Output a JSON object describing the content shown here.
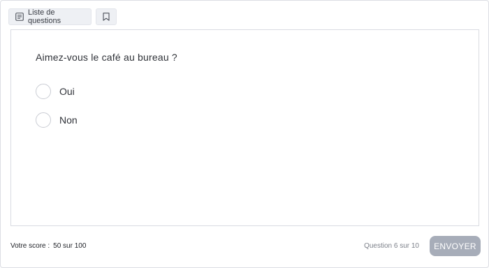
{
  "toolbar": {
    "list_label": "Liste de questions",
    "list_icon": "list-icon",
    "bookmark_icon": "bookmark-icon"
  },
  "question": {
    "text": "Aimez-vous le café au bureau ?",
    "options": [
      {
        "label": "Oui",
        "selected": false
      },
      {
        "label": "Non",
        "selected": false
      }
    ]
  },
  "footer": {
    "score_label": "Votre score :",
    "score_value": "50 sur 100",
    "progress_text": "Question 6 sur 10",
    "submit_label": "ENVOYER"
  },
  "colors": {
    "submit_bg": "#a7adb9",
    "radio_border": "#c9ccd3",
    "toolbar_btn_bg": "#eef0f4"
  }
}
